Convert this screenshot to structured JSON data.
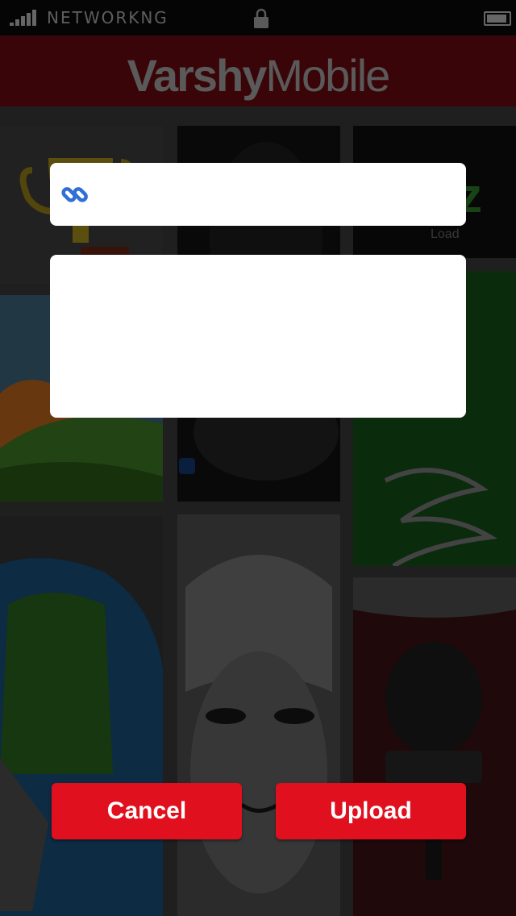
{
  "status_bar": {
    "carrier": "NETWORKNG"
  },
  "header": {
    "logo_bold": "Varshy",
    "logo_light": "Mobile"
  },
  "background": {
    "tile_caption": "Load"
  },
  "dialog": {
    "url_icon": "link-icon",
    "url_value": "",
    "description_value": "",
    "cancel_label": "Cancel",
    "upload_label": "Upload"
  },
  "colors": {
    "accent": "#e0101e",
    "link_icon": "#2f6fd6",
    "header_bg": "#3a0509"
  }
}
